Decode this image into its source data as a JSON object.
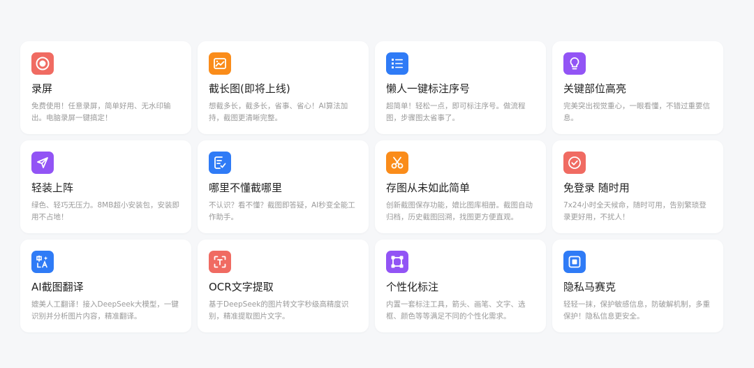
{
  "features": [
    {
      "title": "录屏",
      "desc": "免费使用！任意录屏，简单好用、无水印输出。电脑录屏一键搞定！",
      "color": "#f06b62",
      "icon": "record-icon"
    },
    {
      "title": "截长图(即将上线)",
      "desc": "想截多长，截多长，省事、省心！AI算法加持，截图更清晰完整。",
      "color": "#fa8c1a",
      "icon": "image-icon"
    },
    {
      "title": "懒人一键标注序号",
      "desc": "超简单！轻松一点，即可标注序号。做流程图，步骤图太省事了。",
      "color": "#2f7bf6",
      "icon": "numbered-list-icon"
    },
    {
      "title": "关键部位高亮",
      "desc": "完美突出视觉重心，一眼看懂，不错过重要信息。",
      "color": "#9254f5",
      "icon": "lightbulb-icon"
    },
    {
      "title": "轻装上阵",
      "desc": "绿色、轻巧无压力。8MB超小安装包，安装即用不占地！",
      "color": "#9254f5",
      "icon": "send-icon"
    },
    {
      "title": "哪里不懂截哪里",
      "desc": "不认识？看不懂？截图即答疑，AI秒变全能工作助手。",
      "color": "#2f7bf6",
      "icon": "document-check-icon"
    },
    {
      "title": "存图从未如此简单",
      "desc": "创新截图保存功能，媲比图库相册。截图自动归档，历史截图回溯，找图更方便直观。",
      "color": "#fa8c1a",
      "icon": "scissors-icon"
    },
    {
      "title": "免登录 随时用",
      "desc": "7x24小时全天候命，随时可用，告别繁琐登录更好用，不扰人！",
      "color": "#f06b62",
      "icon": "check-circle-icon"
    },
    {
      "title": "AI截图翻译",
      "desc": "媲美人工翻译！接入DeepSeek大模型，一键识别并分析图片内容，精准翻译。",
      "color": "#2f7bf6",
      "icon": "translate-icon"
    },
    {
      "title": "OCR文字提取",
      "desc": "基于DeepSeek的图片转文字秒级高精度识别，精准提取图片文字。",
      "color": "#f06b62",
      "icon": "text-scan-icon"
    },
    {
      "title": "个性化标注",
      "desc": "内置一套标注工具，箭头、画笔、文字、选框、颜色等等满足不同的个性化需求。",
      "color": "#9254f5",
      "icon": "frame-icon"
    },
    {
      "title": "隐私马赛克",
      "desc": "轻轻一抹，保护敏感信息，防破解机制，多重保护！隐私信息更安全。",
      "color": "#2f7bf6",
      "icon": "mosaic-icon"
    }
  ]
}
